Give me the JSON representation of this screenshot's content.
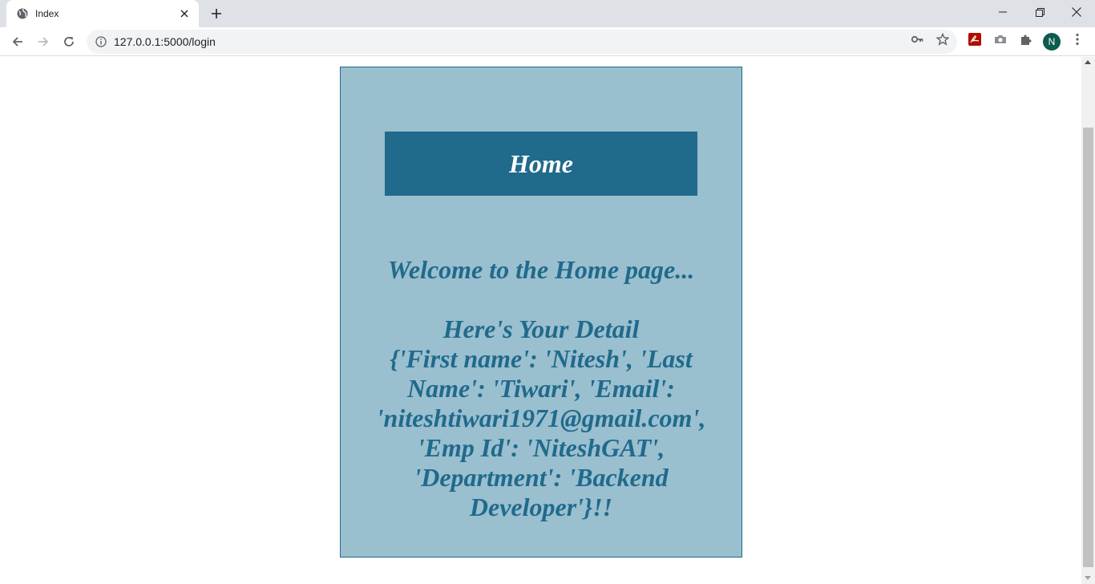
{
  "browser": {
    "tab_title": "Index",
    "url": "127.0.0.1:5000/login",
    "avatar_letter": "N"
  },
  "page": {
    "banner": "Home",
    "welcome": "Welcome to the Home page...",
    "detail_heading": "Here's Your Detail",
    "detail_body": "{'First name': 'Nitesh', 'Last Name': 'Tiwari', 'Email': 'niteshtiwari1971@gmail.com', 'Emp Id': 'NiteshGAT', 'Department': 'Backend Developer'}!!"
  },
  "colors": {
    "card_bg": "#9abfcf",
    "accent": "#206a8c"
  }
}
